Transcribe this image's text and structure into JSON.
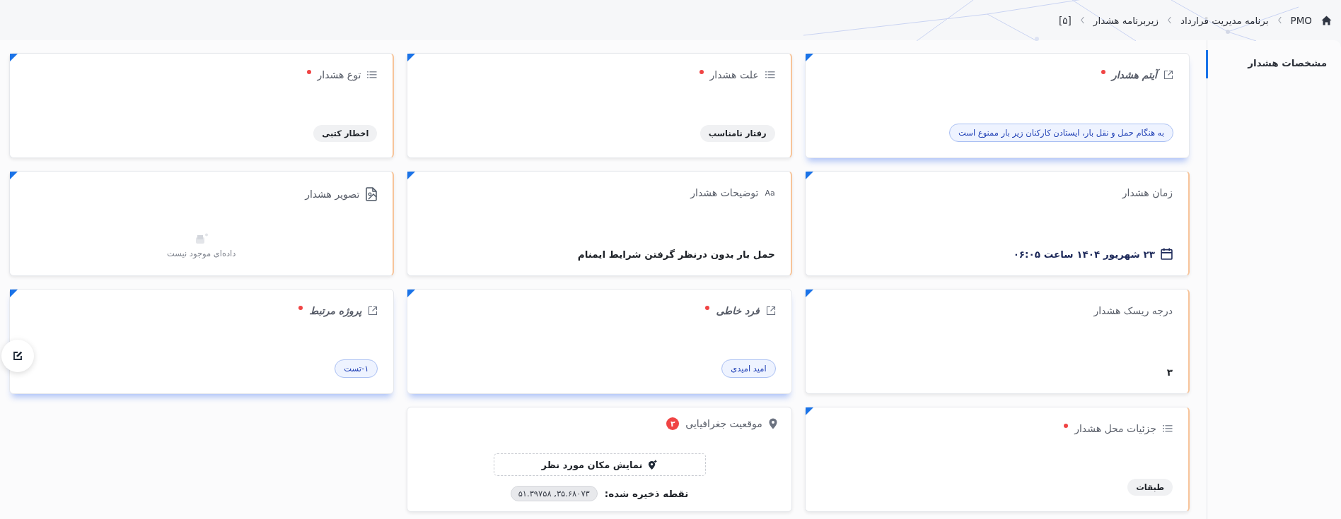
{
  "breadcrumb": [
    {
      "label": "PMO",
      "kind": "home"
    },
    {
      "label": "برنامه مدیریت قرارداد",
      "kind": "link"
    },
    {
      "label": "زیربرنامه هشدار",
      "kind": "link"
    },
    {
      "label": "[۵]",
      "kind": "link"
    }
  ],
  "sidebar": {
    "items": [
      {
        "label": "مشخصات هشدار",
        "selected": true
      }
    ]
  },
  "cards": [
    {
      "kind": "link",
      "title": "آیتم هشدار",
      "required": true,
      "value": "به هنگام حمل و نقل بار، ایستادن کارکنان زیر بار ممنوع است"
    },
    {
      "kind": "list",
      "title": "علت هشدار",
      "required": true,
      "value": "رفتار نامناسب"
    },
    {
      "kind": "list",
      "title": "توع هشدار",
      "required": true,
      "value": "اخطار کتبی"
    },
    {
      "kind": "date",
      "title": "زمان هشدار",
      "required": false,
      "value": "۲۳ شهریور ۱۴۰۴ ساعت ۰۶:۰۵"
    },
    {
      "kind": "text",
      "title": "توضیحات هشدار",
      "required": false,
      "icon_text": "Aa",
      "value": "حمل بار بدون درنظر گرفتن شرایط ایمنام"
    },
    {
      "kind": "image",
      "title": "تصویر هشدار",
      "required": false,
      "empty_text": "داده‌ای موجود نیست"
    },
    {
      "kind": "plain",
      "title": "درجه ریسک هشدار",
      "required": false,
      "value": "۳"
    },
    {
      "kind": "link",
      "title": "فرد خاطی",
      "required": true,
      "value": "امید امیدی"
    },
    {
      "kind": "link",
      "title": "پروژه مرتبط",
      "required": true,
      "value": "۱-تست"
    },
    {
      "kind": "list",
      "title": "جزئیات محل هشدار",
      "required": true,
      "value": "طبقات"
    },
    {
      "kind": "location",
      "title": "موقعیت جغرافیایی",
      "required": false,
      "badge": "۲",
      "button": "نمایش مکان مورد نظر",
      "saved_label": "نقطه ذخیره شده:",
      "saved_value": "۳۵.۶۸۰۷۳, ۵۱.۳۹۷۵۸"
    }
  ]
}
